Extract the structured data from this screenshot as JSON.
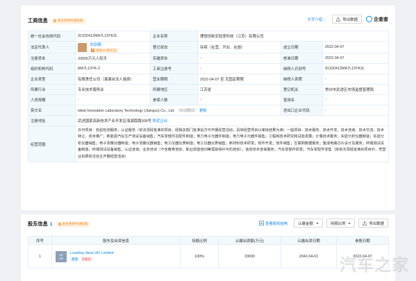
{
  "section1": {
    "title": "工商信息",
    "tag": "发生变更时通知我",
    "text_link": "文字介绍",
    "export_btn": "导出数据",
    "brand": "企查查"
  },
  "rows": [
    [
      {
        "l": "统一社会信用代码"
      },
      {
        "v": "91320412MA7L13YK2L"
      },
      {
        "l": "企业名称"
      },
      {
        "v": "理想创新实验室科技（江苏）有限公司",
        "span": 3
      }
    ],
    [
      {
        "l": "法定代表人"
      },
      {
        "rep": true
      },
      {
        "l": "登记状态"
      },
      {
        "v": "存续（在营、开业、在册）"
      },
      {
        "l": "成立日期"
      },
      {
        "v": "2022-04-07"
      }
    ],
    [
      {
        "l": "注册资本"
      },
      {
        "v": "33000万元人民币"
      },
      {
        "l": "实缴资本"
      },
      {
        "v": "-"
      },
      {
        "l": "核准日期"
      },
      {
        "v": "2022-04-07"
      }
    ],
    [
      {
        "l": "组织机构代码"
      },
      {
        "v": "MA7L13YK-2"
      },
      {
        "l": "工商注册号"
      },
      {
        "v": "-"
      },
      {
        "l": "纳税人识别号"
      },
      {
        "v": "91320412MA7L13YK2L"
      }
    ],
    [
      {
        "l": "企业类型"
      },
      {
        "v": "有限责任公司（港澳台法人独资）"
      },
      {
        "l": "营业期限"
      },
      {
        "v": "2022-04-07 至 无固定期限"
      },
      {
        "l": "纳税人资质"
      },
      {
        "v": "-"
      }
    ],
    [
      {
        "l": "所属行业"
      },
      {
        "v": "专业技术服务业"
      },
      {
        "l": "所属地区"
      },
      {
        "v": "江苏省"
      },
      {
        "l": "登记机关"
      },
      {
        "v": "常州市武进区市场监督管理局"
      }
    ],
    [
      {
        "l": "人员规模"
      },
      {
        "v": "-"
      },
      {
        "l": "参保人数"
      },
      {
        "v": "-"
      },
      {
        "l": "曾用名"
      },
      {
        "v": "-"
      }
    ],
    [
      {
        "l": "英文名"
      },
      {
        "en": true,
        "span": 3
      },
      {
        "l": "进出口企业代码"
      },
      {
        "v": "-"
      }
    ],
    [
      {
        "l": "注册地址"
      },
      {
        "addr": true,
        "span": 5
      }
    ],
    [
      {
        "l": "经营范围"
      },
      {
        "scope": true,
        "span": 5
      }
    ]
  ],
  "legal_rep": {
    "name": "沈亚楠",
    "sub": "关联104家企业"
  },
  "english": {
    "name": "Ideal Innovation Laboratory Technology (Jiangsu) Co., Ltd.",
    "note": "（自动翻译）",
    "more": "更新"
  },
  "address": {
    "text": "武进国家高新技术产业开发区海湖南路308号",
    "link": "附近企业"
  },
  "scope_text": "许可项目：检验检测服务；认证服务（依法须经批准的项目，经相关部门批准后方可开展经营活动，具体经营项目以审批结果为准）一般项目：技术服务、技术开发、技术咨询、技术交流、技术转让、技术推广；新能源汽车生产测试设备销售；汽车零部件及配件制造；电力电子元器件制造；电力电子元器件销售；工程和技术研究和试验发展；计量技术服务；实验分析仪器制造；实验分析仪器销售；电子测量仪器制造；电子测量仪器销售；电工仪器仪表制造；电工仪器仪表销售；新材料技术研发；软件开发；软件销售；互联网数据服务；集成电路芯片设计及服务；终端测试设备制造；终端测试设备销售；认证咨询；业务培训（不含教育培训、职业技能培训等需取得许可的培训）；信息技术咨询服务；汽车零部件研发；汽车零配件零售（除依法须经批准的项目外，凭营业执照依法自主开展经营活动）",
  "section2": {
    "title": "股东信息",
    "count": "1",
    "tag": "发生变更时通知我",
    "view_chart": "查看股权结构",
    "filter1": "认缴金额",
    "filter2": "持股比例",
    "export_btn": "导出数据",
    "columns": [
      "序号",
      "股东及出资信息",
      "持股比例",
      "认缴出资额(万元)",
      "认缴出资日期",
      "参股日期"
    ],
    "rows": [
      {
        "idx": "1",
        "logo": [
          "LE",
          "AD"
        ],
        "name": "Leading Ideal HK Limited",
        "chips": [
          "香港",
          "大股东"
        ],
        "ratio": "100%",
        "amount": "33000",
        "date1": "2042-04-01",
        "date2": "2022-04-07"
      }
    ]
  },
  "watermark": "汽车之家",
  "colors": {
    "link": "#128bed",
    "label_bg": "#f2f9fc",
    "orange": "#f5891f"
  }
}
